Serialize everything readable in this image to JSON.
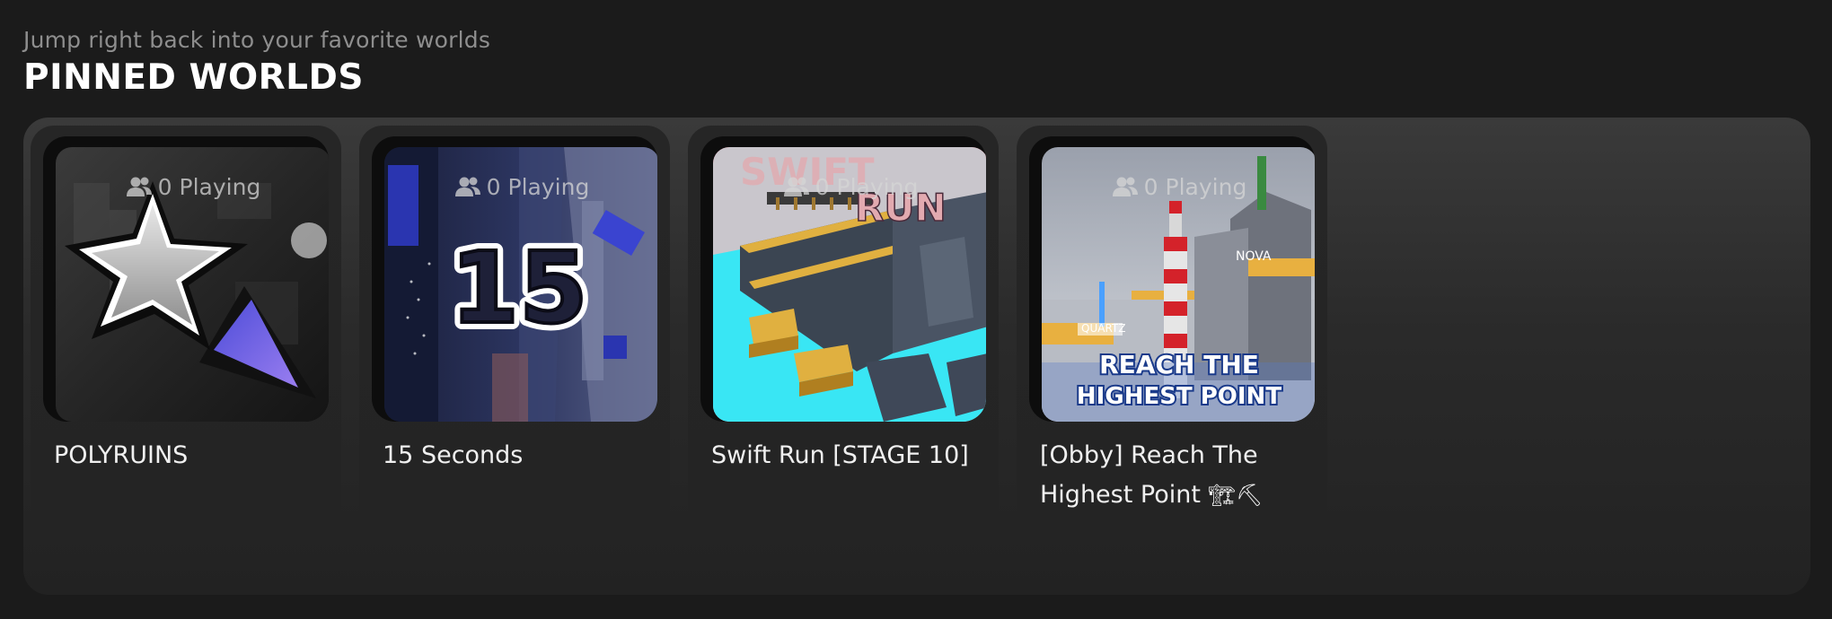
{
  "header": {
    "subtitle": "Jump right back into your favorite worlds",
    "title": "PINNED WORLDS"
  },
  "cards": [
    {
      "name": "POLYRUINS",
      "playing": "0 Playing",
      "thumb_text": ""
    },
    {
      "name": "15 Seconds",
      "playing": "0 Playing",
      "thumb_text": "15"
    },
    {
      "name": "Swift Run [STAGE 10]",
      "playing": "0 Playing",
      "thumb_text_1": "SWIFT",
      "thumb_text_2": "RUN"
    },
    {
      "name_line1": "[Obby] Reach The",
      "name_line2": "Highest Point",
      "name_emoji": "🏗⛏",
      "playing": "0 Playing",
      "thumb_text_1": "REACH THE",
      "thumb_text_2": "HIGHEST POINT",
      "thumb_sign_1": "QUARTZ",
      "thumb_sign_2": "NOVA"
    }
  ],
  "colors": {
    "background": "#1b1b1b",
    "panel": "#2f2f2f",
    "card": "#252525",
    "subtitle": "#8e8e8e",
    "accent_swift": "#39e6f4"
  },
  "icons": {
    "users": "users-icon"
  }
}
